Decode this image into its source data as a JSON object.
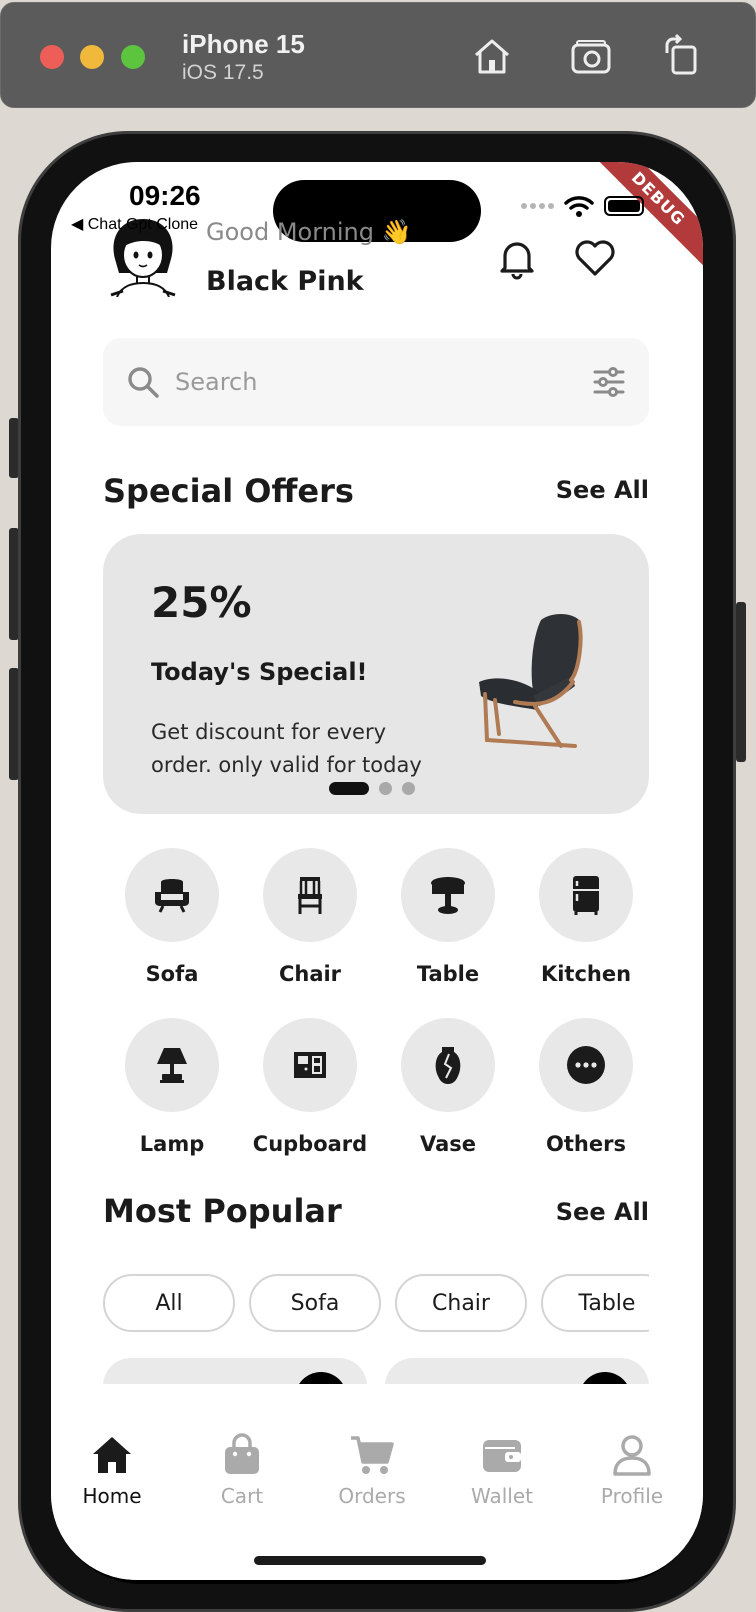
{
  "simulator": {
    "device": "iPhone 15",
    "os": "iOS 17.5",
    "buttons": [
      "home-icon",
      "screenshot-icon",
      "rotate-icon"
    ]
  },
  "status_bar": {
    "time": "09:26",
    "back_app": "◀ Chat Gpt Clone",
    "debug_banner": "DEBUG"
  },
  "header": {
    "greeting": "Good Morning 👋",
    "username": "Black Pink",
    "icons": [
      "bell-icon",
      "heart-icon"
    ]
  },
  "search": {
    "placeholder": "Search",
    "value": ""
  },
  "special_offers": {
    "title": "Special Offers",
    "see_all": "See All",
    "banner": {
      "percent": "25%",
      "heading": "Today's Special!",
      "description": "Get discount for every order. only valid for today"
    },
    "pager": {
      "count": 3,
      "active": 0
    }
  },
  "categories": [
    {
      "label": "Sofa",
      "icon": "sofa-icon"
    },
    {
      "label": "Chair",
      "icon": "chair-icon"
    },
    {
      "label": "Table",
      "icon": "table-icon"
    },
    {
      "label": "Kitchen",
      "icon": "fridge-icon"
    },
    {
      "label": "Lamp",
      "icon": "lamp-icon"
    },
    {
      "label": "Cupboard",
      "icon": "cupboard-icon"
    },
    {
      "label": "Vase",
      "icon": "vase-icon"
    },
    {
      "label": "Others",
      "icon": "more-icon"
    }
  ],
  "most_popular": {
    "title": "Most Popular",
    "see_all": "See All",
    "filters": [
      "All",
      "Sofa",
      "Chair",
      "Table"
    ]
  },
  "bottom_nav": {
    "items": [
      {
        "label": "Home",
        "icon": "home-icon",
        "active": true
      },
      {
        "label": "Cart",
        "icon": "bag-icon",
        "active": false
      },
      {
        "label": "Orders",
        "icon": "cart-icon",
        "active": false
      },
      {
        "label": "Wallet",
        "icon": "wallet-icon",
        "active": false
      },
      {
        "label": "Profile",
        "icon": "user-icon",
        "active": false
      }
    ]
  },
  "colors": {
    "accent": "#111111",
    "inactive": "#aaaaaa",
    "card_bg": "#e6e6e6",
    "debug": "#b23a3a"
  }
}
